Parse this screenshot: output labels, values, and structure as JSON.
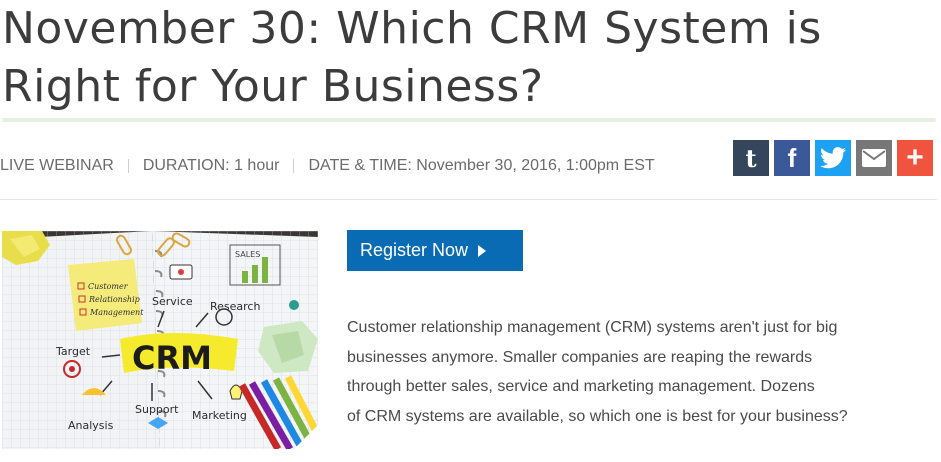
{
  "page": {
    "title_line1": "November 30: Which CRM System is",
    "title_line2": "Right for Your Business?"
  },
  "meta": {
    "type": "LIVE WEBINAR",
    "duration": "DURATION: 1 hour",
    "datetime": "DATE & TIME: November 30, 2016, 1:00pm EST"
  },
  "share": {
    "buttons": [
      {
        "name": "tumblr",
        "glyph": "t",
        "color": "#35465c"
      },
      {
        "name": "facebook",
        "glyph": "f",
        "color": "#3b5998"
      },
      {
        "name": "twitter",
        "glyph": "bird",
        "color": "#1da1f2"
      },
      {
        "name": "email",
        "glyph": "envelope",
        "color": "#777777"
      },
      {
        "name": "more",
        "glyph": "+",
        "color": "#f0533e"
      }
    ]
  },
  "hero": {
    "center_word": "CRM",
    "note_items": [
      "Customer",
      "Relationship",
      "Management"
    ],
    "labels": {
      "service": "Service",
      "research": "Research",
      "target": "Target",
      "analysis": "Analysis",
      "support": "Support",
      "marketing": "Marketing",
      "sales": "SALES"
    }
  },
  "cta": {
    "register_label": "Register Now"
  },
  "description": {
    "lines": [
      "Customer relationship management (CRM) systems aren't just for big",
      "businesses anymore. Smaller companies are reaping the rewards",
      "through better sales, service and marketing management. Dozens",
      "of CRM systems are available, so which one is best for your business?"
    ]
  },
  "colors": {
    "accent": "#0a6bb5",
    "title_text": "#3c3c3c",
    "divider_green": "#e8efe0"
  }
}
